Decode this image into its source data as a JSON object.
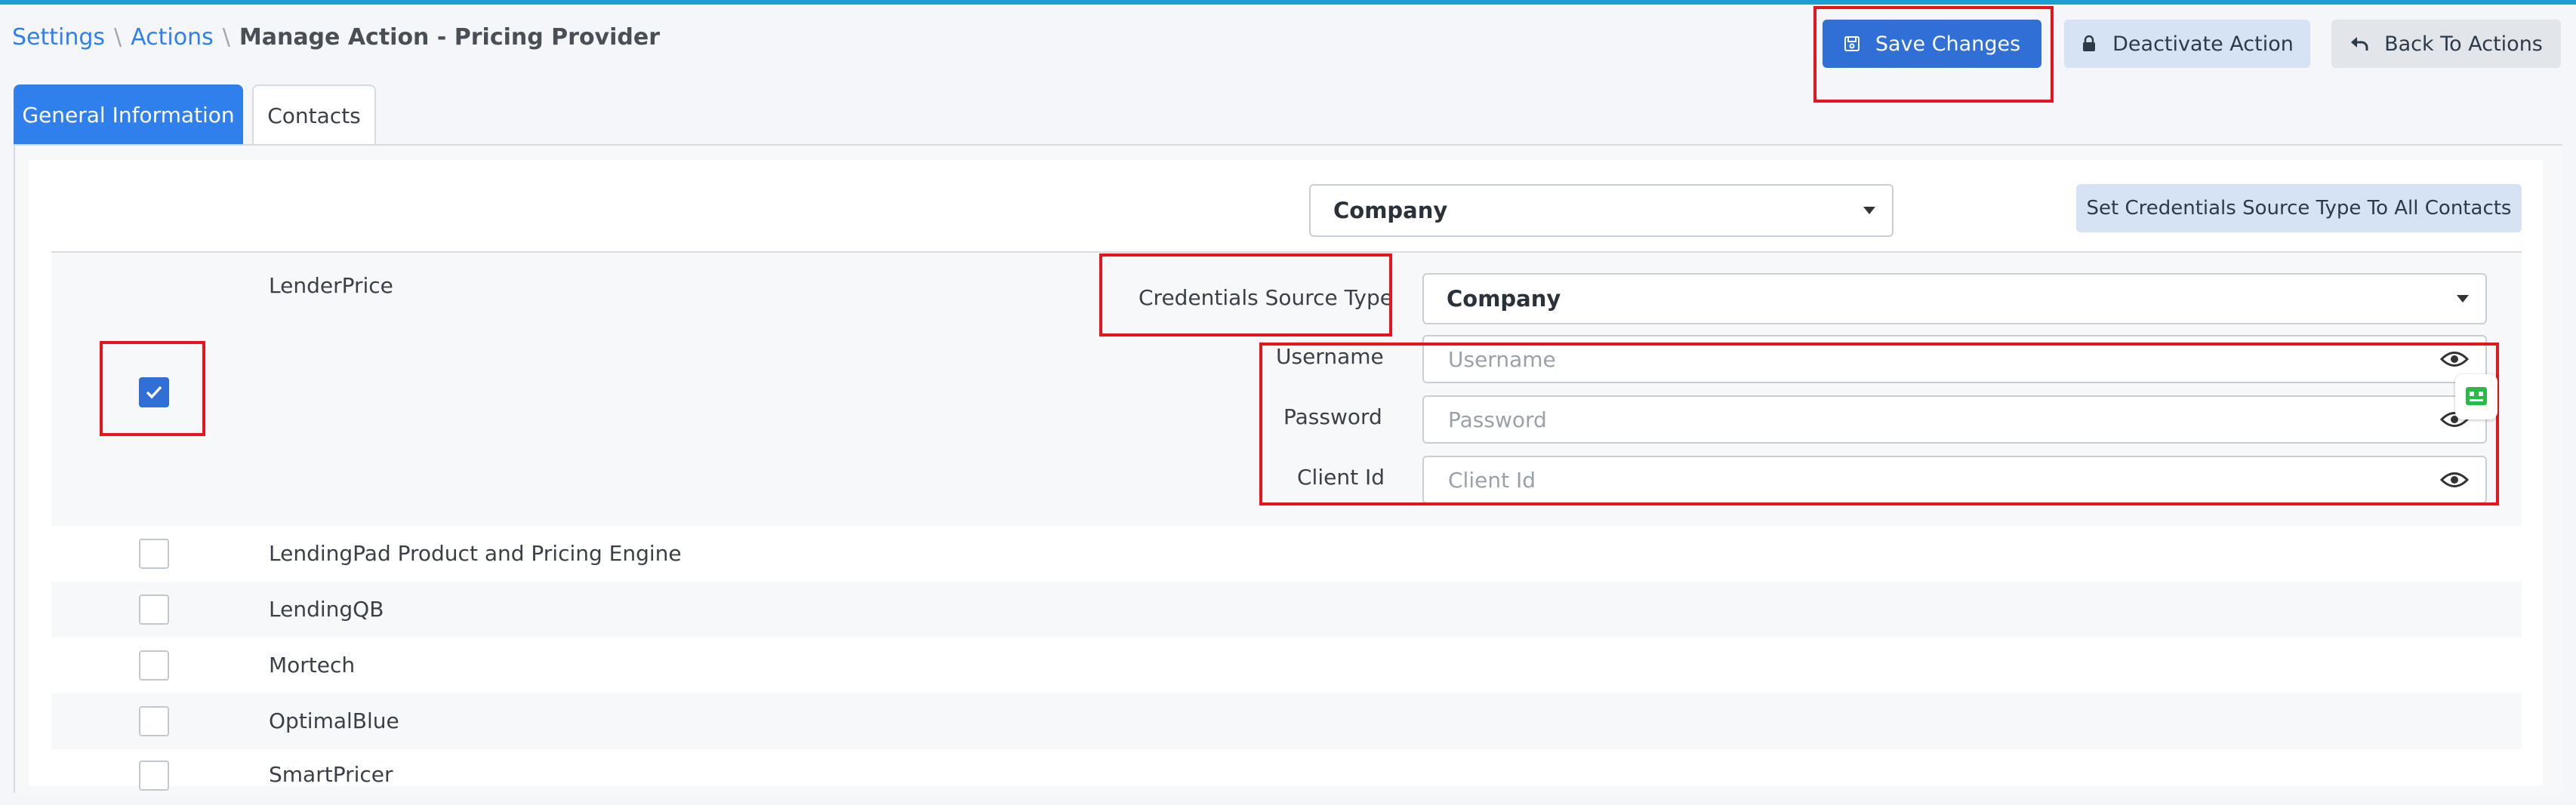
{
  "breadcrumb": {
    "items": [
      "Settings",
      "Actions"
    ],
    "current": "Manage Action - Pricing Provider"
  },
  "toolbar": {
    "save_label": "Save Changes",
    "deactivate_label": "Deactivate Action",
    "back_label": "Back To Actions"
  },
  "tabs": [
    {
      "label": "General Information",
      "active": true
    },
    {
      "label": "Contacts",
      "active": false
    }
  ],
  "bulk": {
    "source_type_value": "Company",
    "set_all_label": "Set Credentials Source Type To All Contacts"
  },
  "selected_contact": {
    "name": "LenderPrice",
    "checked": true,
    "source_type_label": "Credentials Source Type",
    "source_type_value": "Company",
    "username_label": "Username",
    "username_placeholder": "Username",
    "password_label": "Password",
    "password_placeholder": "Password",
    "client_id_label": "Client Id",
    "client_id_placeholder": "Client Id"
  },
  "contacts": [
    {
      "name": "LendingPad Product and Pricing Engine",
      "checked": false
    },
    {
      "name": "LendingQB",
      "checked": false
    },
    {
      "name": "Mortech",
      "checked": false
    },
    {
      "name": "OptimalBlue",
      "checked": false
    },
    {
      "name": "SmartPricer",
      "checked": false
    }
  ],
  "colors": {
    "primary": "#2f6fd6",
    "tab_active": "#2f80ed",
    "highlight": "#e8141b",
    "secondary_button": "#d5e3f5"
  },
  "icons": [
    "save-icon",
    "lock-icon",
    "back-arrow-icon",
    "eye-icon",
    "check-icon",
    "caret-down-icon",
    "extension-icon"
  ]
}
